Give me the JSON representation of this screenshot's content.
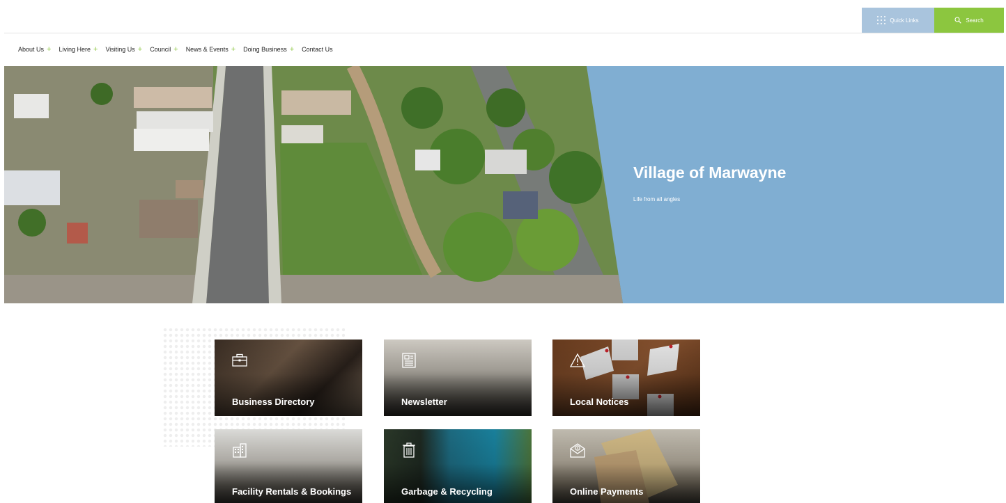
{
  "utility_bar": {
    "quick_links_label": "Quick Links",
    "search_label": "Search",
    "quick_links_color": "#a9c4dd",
    "search_color": "#8cc63f"
  },
  "nav": {
    "items": [
      {
        "label": "About Us",
        "has_submenu": true
      },
      {
        "label": "Living Here",
        "has_submenu": true
      },
      {
        "label": "Visiting Us",
        "has_submenu": true
      },
      {
        "label": "Council",
        "has_submenu": true
      },
      {
        "label": "News & Events",
        "has_submenu": true
      },
      {
        "label": "Doing Business",
        "has_submenu": true
      },
      {
        "label": "Contact Us",
        "has_submenu": false
      }
    ],
    "plus_symbol": "+",
    "accent_color": "#8cc63f"
  },
  "hero": {
    "title": "Village of Marwayne",
    "subtitle": "Life from all angles",
    "panel_color": "#80aed2"
  },
  "tiles": [
    {
      "label": "Business Directory",
      "icon": "briefcase-icon"
    },
    {
      "label": "Newsletter",
      "icon": "newspaper-icon"
    },
    {
      "label": "Local Notices",
      "icon": "warning-icon"
    },
    {
      "label": "Facility Rentals & Bookings",
      "icon": "building-icon"
    },
    {
      "label": "Garbage & Recycling",
      "icon": "trash-icon"
    },
    {
      "label": "Online Payments",
      "icon": "payment-envelope-icon"
    }
  ]
}
